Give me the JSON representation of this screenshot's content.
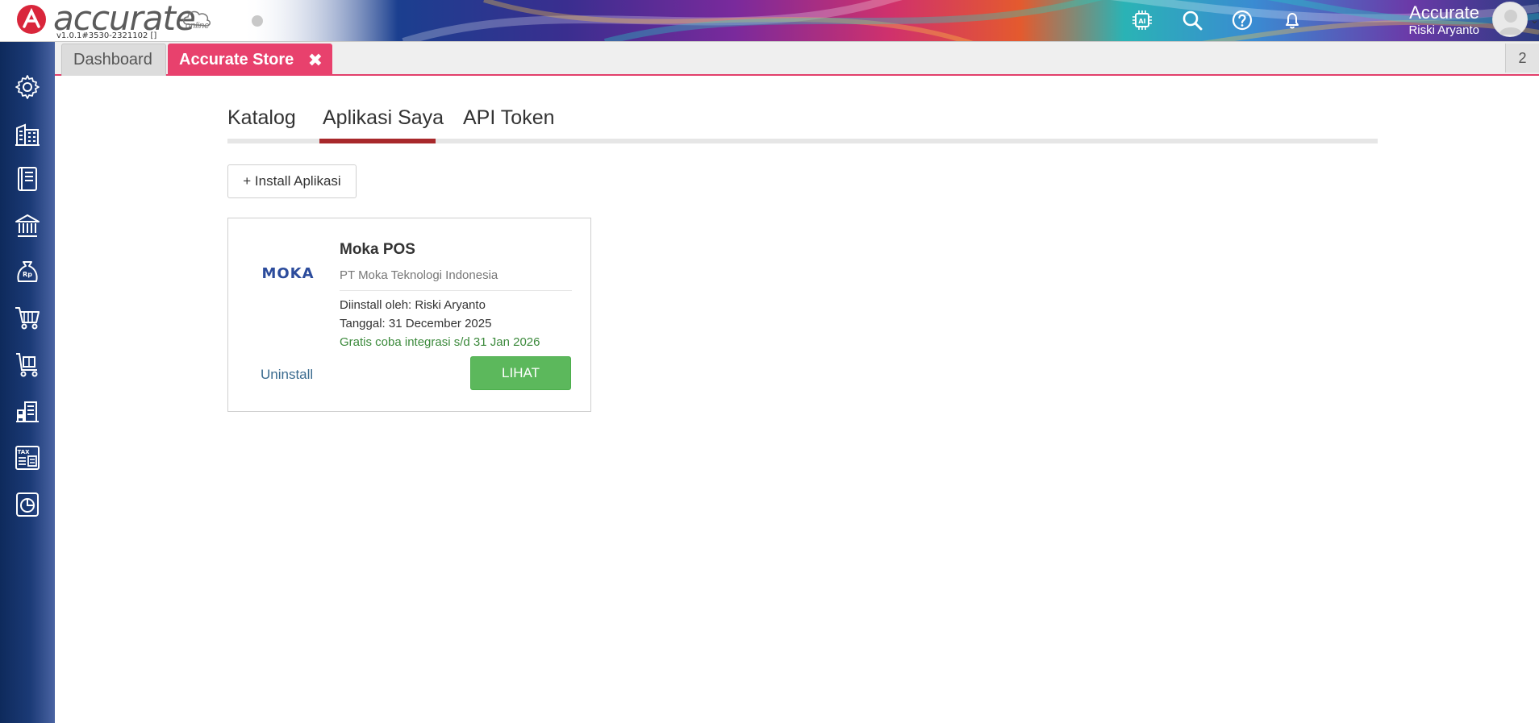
{
  "header": {
    "logo_text": "accurate",
    "logo_sub": "online",
    "version": "v1.0.1#3530-2321102 []",
    "company": "Accurate",
    "user": "Riski Aryanto",
    "icons": [
      "ai-chip-icon",
      "search-icon",
      "help-icon",
      "bell-icon"
    ]
  },
  "sidebar": {
    "items": [
      "settings-icon",
      "company-icon",
      "ledger-book-icon",
      "bank-icon",
      "sales-money-bag-icon",
      "shopping-cart-icon",
      "delivery-cart-icon",
      "inventory-icon",
      "tax-report-icon",
      "analytics-icon"
    ]
  },
  "tabs": {
    "dashboard": "Dashboard",
    "store": "Accurate Store",
    "close": "✖",
    "count": "2"
  },
  "subtabs": {
    "katalog": "Katalog",
    "aplikasi_saya": "Aplikasi Saya",
    "api_token": "API Token",
    "active": "Aplikasi Saya"
  },
  "install_button": "+ Install Aplikasi",
  "app_card": {
    "logo_text": "MOKA",
    "title": "Moka POS",
    "vendor": "PT Moka Teknologi Indonesia",
    "installed_by": "Diinstall oleh: Riski Aryanto",
    "date": "Tanggal: 31 December 2025",
    "trial": "Gratis coba integrasi s/d 31 Jan 2026",
    "uninstall": "Uninstall",
    "view": "LIHAT"
  },
  "colors": {
    "accent_tab": "#e8416d",
    "active_underline": "#a8282b",
    "primary_button": "#5cb85c",
    "sidebar": "#1b3a76"
  }
}
